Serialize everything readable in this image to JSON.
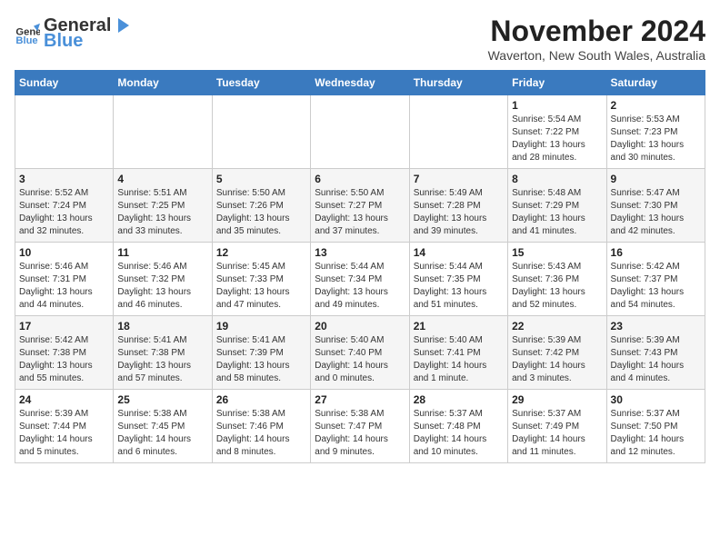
{
  "header": {
    "logo_general": "General",
    "logo_blue": "Blue",
    "title": "November 2024",
    "subtitle": "Waverton, New South Wales, Australia"
  },
  "days_of_week": [
    "Sunday",
    "Monday",
    "Tuesday",
    "Wednesday",
    "Thursday",
    "Friday",
    "Saturday"
  ],
  "weeks": [
    [
      {
        "day": "",
        "info": ""
      },
      {
        "day": "",
        "info": ""
      },
      {
        "day": "",
        "info": ""
      },
      {
        "day": "",
        "info": ""
      },
      {
        "day": "",
        "info": ""
      },
      {
        "day": "1",
        "info": "Sunrise: 5:54 AM\nSunset: 7:22 PM\nDaylight: 13 hours and 28 minutes."
      },
      {
        "day": "2",
        "info": "Sunrise: 5:53 AM\nSunset: 7:23 PM\nDaylight: 13 hours and 30 minutes."
      }
    ],
    [
      {
        "day": "3",
        "info": "Sunrise: 5:52 AM\nSunset: 7:24 PM\nDaylight: 13 hours and 32 minutes."
      },
      {
        "day": "4",
        "info": "Sunrise: 5:51 AM\nSunset: 7:25 PM\nDaylight: 13 hours and 33 minutes."
      },
      {
        "day": "5",
        "info": "Sunrise: 5:50 AM\nSunset: 7:26 PM\nDaylight: 13 hours and 35 minutes."
      },
      {
        "day": "6",
        "info": "Sunrise: 5:50 AM\nSunset: 7:27 PM\nDaylight: 13 hours and 37 minutes."
      },
      {
        "day": "7",
        "info": "Sunrise: 5:49 AM\nSunset: 7:28 PM\nDaylight: 13 hours and 39 minutes."
      },
      {
        "day": "8",
        "info": "Sunrise: 5:48 AM\nSunset: 7:29 PM\nDaylight: 13 hours and 41 minutes."
      },
      {
        "day": "9",
        "info": "Sunrise: 5:47 AM\nSunset: 7:30 PM\nDaylight: 13 hours and 42 minutes."
      }
    ],
    [
      {
        "day": "10",
        "info": "Sunrise: 5:46 AM\nSunset: 7:31 PM\nDaylight: 13 hours and 44 minutes."
      },
      {
        "day": "11",
        "info": "Sunrise: 5:46 AM\nSunset: 7:32 PM\nDaylight: 13 hours and 46 minutes."
      },
      {
        "day": "12",
        "info": "Sunrise: 5:45 AM\nSunset: 7:33 PM\nDaylight: 13 hours and 47 minutes."
      },
      {
        "day": "13",
        "info": "Sunrise: 5:44 AM\nSunset: 7:34 PM\nDaylight: 13 hours and 49 minutes."
      },
      {
        "day": "14",
        "info": "Sunrise: 5:44 AM\nSunset: 7:35 PM\nDaylight: 13 hours and 51 minutes."
      },
      {
        "day": "15",
        "info": "Sunrise: 5:43 AM\nSunset: 7:36 PM\nDaylight: 13 hours and 52 minutes."
      },
      {
        "day": "16",
        "info": "Sunrise: 5:42 AM\nSunset: 7:37 PM\nDaylight: 13 hours and 54 minutes."
      }
    ],
    [
      {
        "day": "17",
        "info": "Sunrise: 5:42 AM\nSunset: 7:38 PM\nDaylight: 13 hours and 55 minutes."
      },
      {
        "day": "18",
        "info": "Sunrise: 5:41 AM\nSunset: 7:38 PM\nDaylight: 13 hours and 57 minutes."
      },
      {
        "day": "19",
        "info": "Sunrise: 5:41 AM\nSunset: 7:39 PM\nDaylight: 13 hours and 58 minutes."
      },
      {
        "day": "20",
        "info": "Sunrise: 5:40 AM\nSunset: 7:40 PM\nDaylight: 14 hours and 0 minutes."
      },
      {
        "day": "21",
        "info": "Sunrise: 5:40 AM\nSunset: 7:41 PM\nDaylight: 14 hours and 1 minute."
      },
      {
        "day": "22",
        "info": "Sunrise: 5:39 AM\nSunset: 7:42 PM\nDaylight: 14 hours and 3 minutes."
      },
      {
        "day": "23",
        "info": "Sunrise: 5:39 AM\nSunset: 7:43 PM\nDaylight: 14 hours and 4 minutes."
      }
    ],
    [
      {
        "day": "24",
        "info": "Sunrise: 5:39 AM\nSunset: 7:44 PM\nDaylight: 14 hours and 5 minutes."
      },
      {
        "day": "25",
        "info": "Sunrise: 5:38 AM\nSunset: 7:45 PM\nDaylight: 14 hours and 6 minutes."
      },
      {
        "day": "26",
        "info": "Sunrise: 5:38 AM\nSunset: 7:46 PM\nDaylight: 14 hours and 8 minutes."
      },
      {
        "day": "27",
        "info": "Sunrise: 5:38 AM\nSunset: 7:47 PM\nDaylight: 14 hours and 9 minutes."
      },
      {
        "day": "28",
        "info": "Sunrise: 5:37 AM\nSunset: 7:48 PM\nDaylight: 14 hours and 10 minutes."
      },
      {
        "day": "29",
        "info": "Sunrise: 5:37 AM\nSunset: 7:49 PM\nDaylight: 14 hours and 11 minutes."
      },
      {
        "day": "30",
        "info": "Sunrise: 5:37 AM\nSunset: 7:50 PM\nDaylight: 14 hours and 12 minutes."
      }
    ]
  ]
}
